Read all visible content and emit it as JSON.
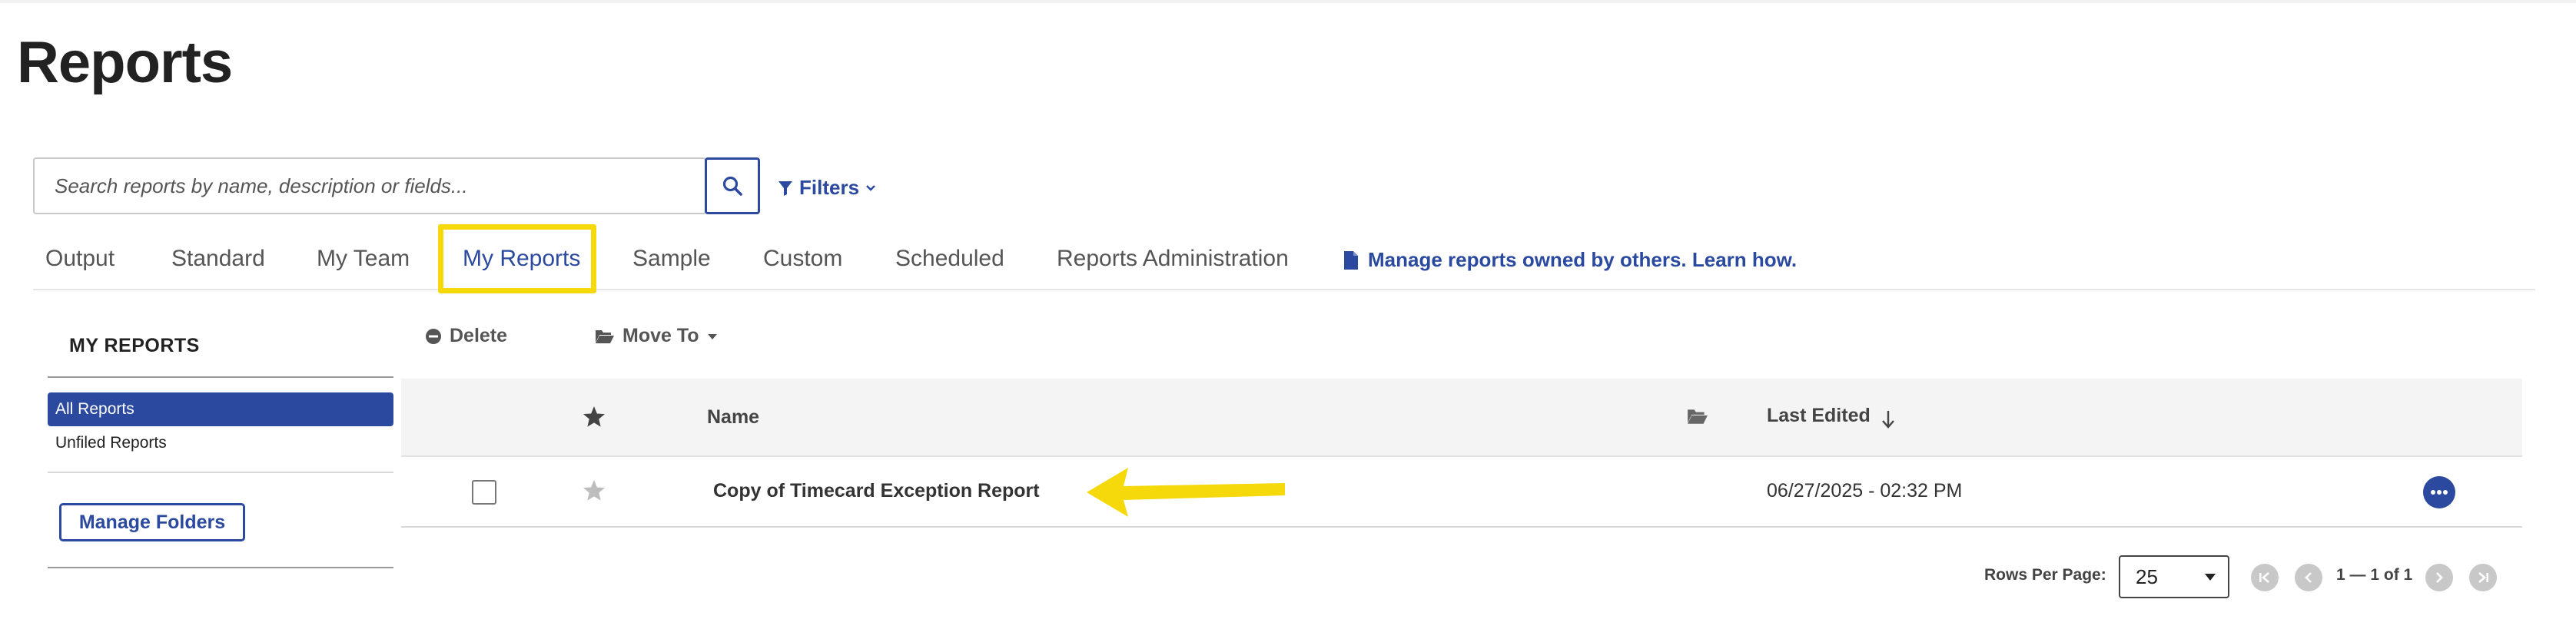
{
  "page": {
    "title": "Reports"
  },
  "search": {
    "placeholder": "Search reports by name, description or fields..."
  },
  "filters": {
    "label": "Filters"
  },
  "tabs": [
    {
      "label": "Output"
    },
    {
      "label": "Standard"
    },
    {
      "label": "My Team"
    },
    {
      "label": "My Reports",
      "active": true
    },
    {
      "label": "Sample"
    },
    {
      "label": "Custom"
    },
    {
      "label": "Scheduled"
    },
    {
      "label": "Reports Administration"
    }
  ],
  "manage_link": {
    "label": "Manage reports owned by others. Learn how."
  },
  "sidebar": {
    "title": "MY REPORTS",
    "items": [
      {
        "label": "All Reports",
        "active": true
      },
      {
        "label": "Unfiled Reports"
      }
    ],
    "manage_folders_label": "Manage Folders"
  },
  "toolbar": {
    "delete_label": "Delete",
    "move_to_label": "Move To"
  },
  "table": {
    "columns": {
      "name": "Name",
      "last_edited": "Last Edited"
    },
    "sort": {
      "column": "last_edited",
      "direction": "descending"
    },
    "rows": [
      {
        "name": "Copy of Timecard Exception Report",
        "last_edited": "06/27/2025 - 02:32 PM",
        "checked": false,
        "starred": false
      }
    ]
  },
  "pagination": {
    "rows_label": "Rows Per Page:",
    "rows_per_page": "25",
    "page_info": "1 — 1 of 1"
  },
  "colors": {
    "accent": "#2b4a9f",
    "highlight": "#f5d90a"
  },
  "annotations": {
    "highlighted_tab": "My Reports",
    "arrow_target": "Copy of Timecard Exception Report"
  }
}
